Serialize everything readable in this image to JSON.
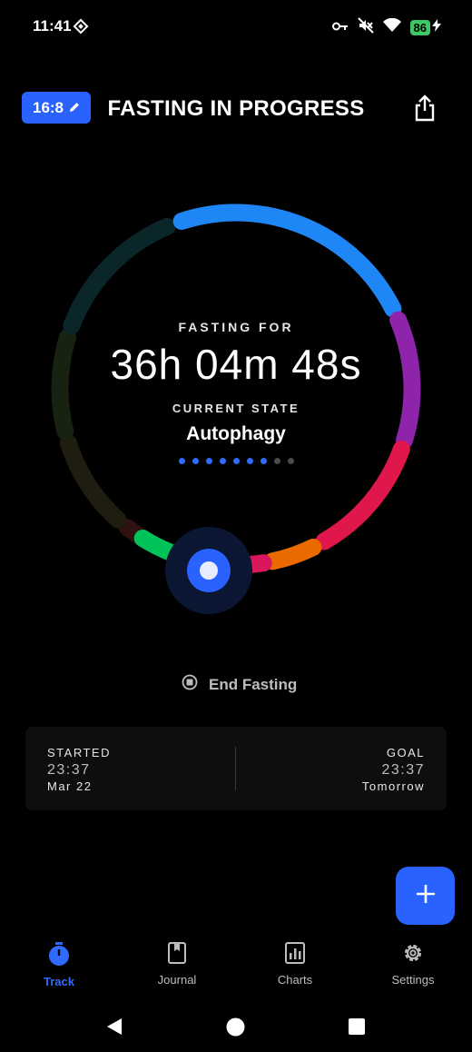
{
  "status_bar": {
    "time": "11:41",
    "battery": "86"
  },
  "header": {
    "plan": "16:8",
    "title": "FASTING IN PROGRESS"
  },
  "timer": {
    "fasting_label": "FASTING FOR",
    "elapsed": "36h 04m 48s",
    "state_label": "CURRENT STATE",
    "state": "Autophagy",
    "stage_count": 9,
    "active_stage_count": 7
  },
  "ring": {
    "segments": [
      {
        "color": "#2f1210"
      },
      {
        "color": "#1f1c10"
      },
      {
        "color": "#182210"
      },
      {
        "color": "#0b2629"
      },
      {
        "color": "#1f86f5"
      },
      {
        "color": "#8e24aa"
      },
      {
        "color": "#e0174a"
      },
      {
        "color": "#ea6a00"
      },
      {
        "color": "#d8175c"
      },
      {
        "color": "#0795e0"
      },
      {
        "color": "#00c35a"
      }
    ],
    "knob_color": "#2962ff"
  },
  "end_button": {
    "label": "End Fasting"
  },
  "started": {
    "label": "STARTED",
    "time": "23:37",
    "date": "Mar 22"
  },
  "goal": {
    "label": "GOAL",
    "time": "23:37",
    "date": "Tomorrow"
  },
  "nav": {
    "track": "Track",
    "journal": "Journal",
    "charts": "Charts",
    "settings": "Settings"
  },
  "accent": "#2962ff"
}
